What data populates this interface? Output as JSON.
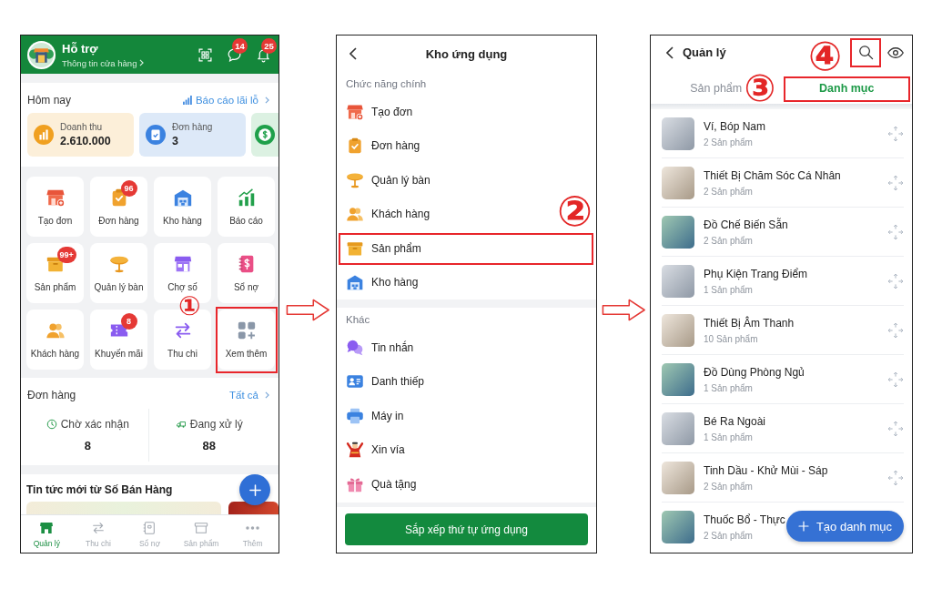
{
  "home": {
    "header": {
      "title": "Hỗ trợ",
      "subtitle": "Thông tin cửa hàng",
      "chat_badge": "14",
      "bell_badge": "25"
    },
    "today": {
      "title": "Hôm nay",
      "link": "Báo cáo lãi lỗ",
      "cards": [
        {
          "kind": "revenue",
          "label": "Doanh thu",
          "value": "2.610.000"
        },
        {
          "kind": "orders",
          "label": "Đơn hàng",
          "value": "3"
        },
        {
          "kind": "cash"
        }
      ]
    },
    "tiles": [
      {
        "kind": "create_order",
        "label": "Tạo đơn",
        "highlighted": false
      },
      {
        "kind": "orders",
        "label": "Đơn hàng",
        "badge": "96",
        "highlighted": false
      },
      {
        "kind": "warehouse",
        "label": "Kho hàng",
        "highlighted": false
      },
      {
        "kind": "report",
        "label": "Báo cáo",
        "highlighted": false
      },
      {
        "kind": "products",
        "label": "Sản phẩm",
        "badge": "99+",
        "highlighted": false
      },
      {
        "kind": "tables",
        "label": "Quản lý bàn",
        "highlighted": false
      },
      {
        "kind": "market",
        "label": "Chợ số",
        "highlighted": false
      },
      {
        "kind": "debt",
        "label": "Sổ nợ",
        "highlighted": false
      },
      {
        "kind": "customers",
        "label": "Khách hàng",
        "highlighted": false
      },
      {
        "kind": "promotions",
        "label": "Khuyến mãi",
        "badge": "8",
        "highlighted": false
      },
      {
        "kind": "cashflow",
        "label": "Thu chi",
        "highlighted": false
      },
      {
        "kind": "more",
        "label": "Xem thêm",
        "highlighted": true,
        "callout": "①"
      }
    ],
    "orders": {
      "title": "Đơn hàng",
      "link": "Tất cả",
      "statuses": [
        {
          "kind": "pending",
          "label": "Chờ xác nhận",
          "value": "8"
        },
        {
          "kind": "processing",
          "label": "Đang xử lý",
          "value": "88"
        }
      ]
    },
    "news": {
      "title": "Tin tức mới từ Số Bán Hàng"
    },
    "bottom_nav": [
      {
        "kind": "manage",
        "label": "Quản lý",
        "selected": true
      },
      {
        "kind": "cashflow",
        "label": "Thu chi",
        "selected": false
      },
      {
        "kind": "debt",
        "label": "Sổ nợ",
        "selected": false
      },
      {
        "kind": "products",
        "label": "Sản phẩm",
        "selected": false
      },
      {
        "kind": "more",
        "label": "Thêm",
        "selected": false
      }
    ]
  },
  "app_store": {
    "title": "Kho ứng dụng",
    "sections": [
      {
        "title": "Chức năng chính",
        "items": [
          {
            "kind": "create_order",
            "label": "Tạo đơn",
            "highlighted": false
          },
          {
            "kind": "orders",
            "label": "Đơn hàng",
            "highlighted": false
          },
          {
            "kind": "tables",
            "label": "Quản lý bàn",
            "highlighted": false
          },
          {
            "kind": "customers",
            "label": "Khách hàng",
            "highlighted": false
          },
          {
            "kind": "products",
            "label": "Sản phẩm",
            "highlighted": true,
            "callout": "②"
          },
          {
            "kind": "warehouse",
            "label": "Kho hàng",
            "highlighted": false
          }
        ]
      },
      {
        "title": "Khác",
        "items": [
          {
            "kind": "messages",
            "label": "Tin nhắn",
            "highlighted": false
          },
          {
            "kind": "business_card",
            "label": "Danh thiếp",
            "highlighted": false
          },
          {
            "kind": "printer",
            "label": "Máy in",
            "highlighted": false
          },
          {
            "kind": "luck",
            "label": "Xin vía",
            "highlighted": false
          },
          {
            "kind": "gifts",
            "label": "Quà tặng",
            "highlighted": false
          }
        ]
      }
    ],
    "button": "Sắp xếp thứ tự ứng dụng"
  },
  "category_manager": {
    "title": "Quản lý",
    "search": {
      "highlighted": true,
      "callout": "④"
    },
    "tabs": [
      {
        "label": "Sản phẩm",
        "selected": false,
        "highlighted": false
      },
      {
        "label": "Danh mục",
        "selected": true,
        "highlighted": true,
        "callout": "③"
      }
    ],
    "categories": [
      {
        "name": "Ví, Bóp Nam",
        "count": "2 Sản phẩm"
      },
      {
        "name": "Thiết Bị Chăm Sóc Cá Nhân",
        "count": "2 Sản phẩm"
      },
      {
        "name": "Đồ Chế Biến Sẵn",
        "count": "2 Sản phẩm"
      },
      {
        "name": "Phụ Kiện Trang Điểm",
        "count": "1 Sản phẩm"
      },
      {
        "name": "Thiết Bị Âm Thanh",
        "count": "10 Sản phẩm"
      },
      {
        "name": "Đồ Dùng Phòng Ngủ",
        "count": "1 Sản phẩm"
      },
      {
        "name": "Bé Ra Ngoài",
        "count": "1 Sản phẩm"
      },
      {
        "name": "Tinh Dầu - Khử Mùi - Sáp",
        "count": "2 Sản phẩm"
      },
      {
        "name": "Thuốc Bổ - Thực",
        "count": "2 Sản phẩm"
      }
    ],
    "create_button": "Tạo danh mục"
  }
}
